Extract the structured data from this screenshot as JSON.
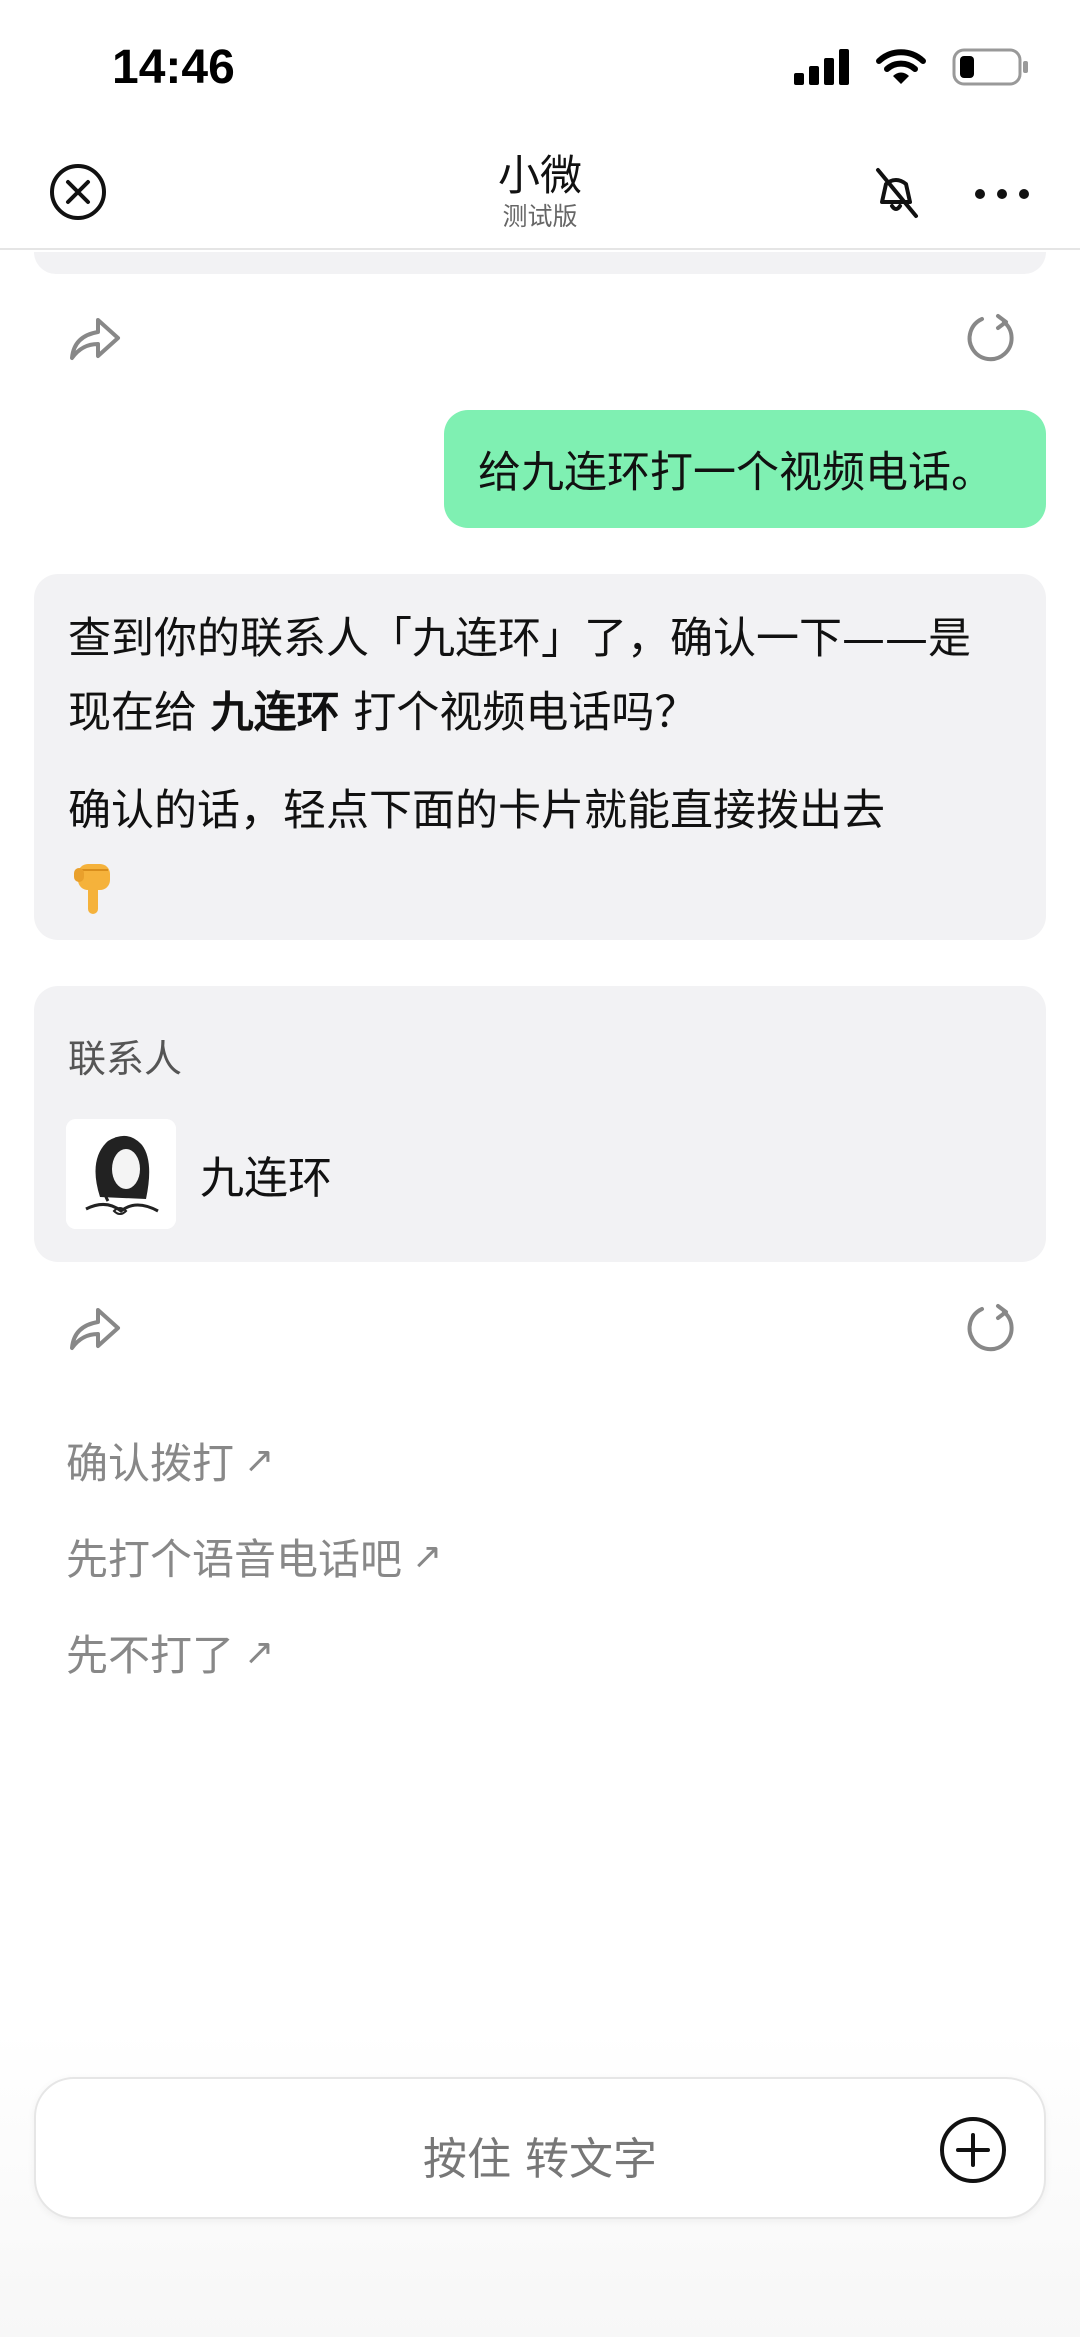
{
  "status_bar": {
    "time": "14:46"
  },
  "nav": {
    "title": "小微",
    "subtitle": "测试版"
  },
  "chat": {
    "user_message": "给九连环打一个视频电话。",
    "bot_reply": {
      "line1_part1": "查到你的联系人「九连环」了，确认一下——是现在给 ",
      "contact_bold": "九连环",
      "line1_part2": " 打个视频电话吗？",
      "line2": "确认的话，轻点下面的卡片就能直接拨出去"
    },
    "contact_card": {
      "header": "联系人",
      "name": "九连环"
    }
  },
  "suggestions": [
    {
      "label": "确认拨打",
      "arrow": "↗"
    },
    {
      "label": "先打个语音电话吧",
      "arrow": "↗"
    },
    {
      "label": "先不打了",
      "arrow": "↗"
    }
  ],
  "input": {
    "hint": "按住 转文字"
  },
  "colors": {
    "user_bubble": "#7ff0b2",
    "bot_bubble": "#f2f2f4",
    "muted_text": "#888888"
  },
  "icons": [
    "close-icon",
    "mute-icon",
    "more-icon",
    "share-icon",
    "refresh-icon",
    "pointing-down-emoji",
    "plus-icon"
  ]
}
